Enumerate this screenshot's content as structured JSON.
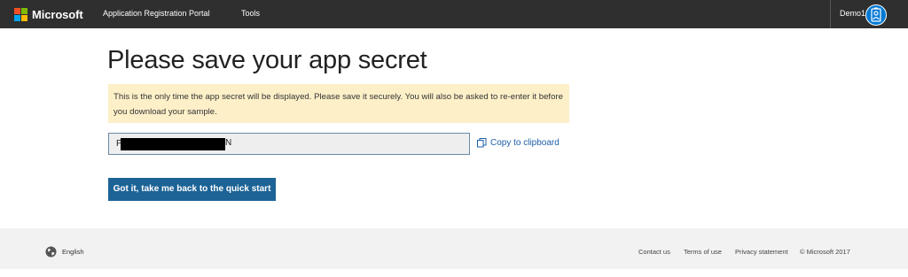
{
  "header": {
    "brand": "Microsoft",
    "nav": {
      "portal": "Application Registration Portal",
      "tools": "Tools"
    },
    "user": "Demo1"
  },
  "main": {
    "title": "Please save your app secret",
    "warning": "This is the only time the app secret will be displayed. Please save it securely. You will also be asked to re-enter it before you download your sample.",
    "secret": {
      "first_char": "P",
      "last_char": "N",
      "redacted": true
    },
    "copy_label": "Copy to clipboard",
    "primary_button": "Got it, take me back to the quick start"
  },
  "footer": {
    "language": "English",
    "links": {
      "contact": "Contact us",
      "terms": "Terms of use",
      "privacy": "Privacy statement",
      "copyright": "© Microsoft 2017"
    }
  },
  "colors": {
    "header_bg": "#2f2f2f",
    "warning_bg": "#fdf0c8",
    "primary": "#1d6396",
    "link": "#1e5fa8",
    "footer_bg": "#f2f2f2",
    "avatar": "#0078d4"
  },
  "icons": {
    "logo": "microsoft-logo-icon",
    "avatar": "user-avatar-icon",
    "copy": "copy-icon",
    "language": "globe-icon"
  }
}
